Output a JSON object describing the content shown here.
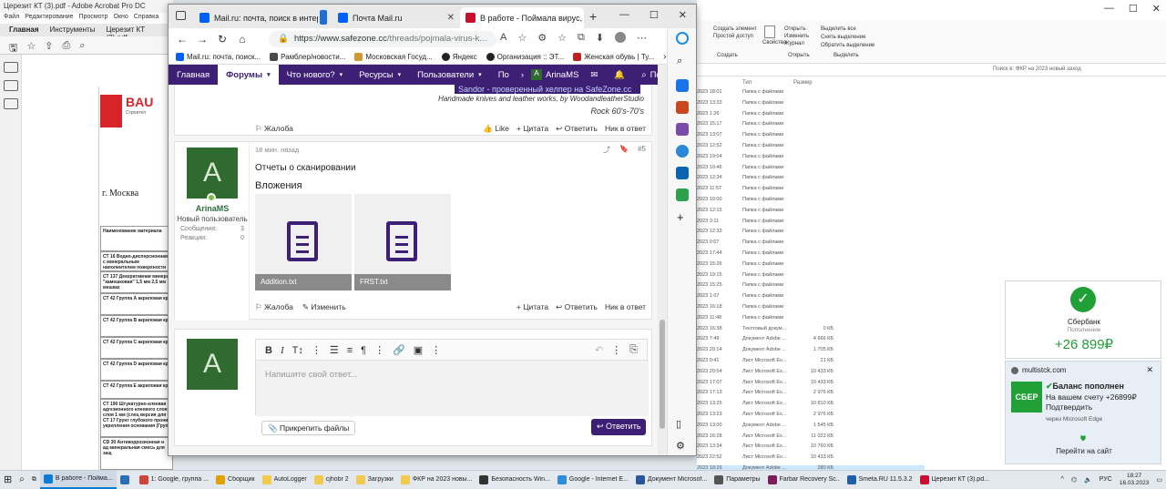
{
  "acrobat": {
    "title": "Церезит КТ (3).pdf - Adobe Acrobat Pro DC",
    "menu": [
      "Файл",
      "Редактирование",
      "Просмотр",
      "Окно",
      "Справка"
    ],
    "tabs": [
      "Главная",
      "Инструменты",
      "Церезит КТ (3).pdf"
    ],
    "logo_text": "BAU",
    "logo_sub": "Строител",
    "city": "г. Москва",
    "table_header": "Наименование материала",
    "rows": [
      "СТ 16 Водно-дисперсионная с минеральным наполнителем поверхности",
      "СТ 137 Декоративная минера \"камешковая\" 1,5 мм 2,5 мм мешках",
      "СТ 42 Группа А акриловая кр",
      "СТ 42 Группа В акриловая кр",
      "СТ 42 Группа С акриловая кр",
      "СТ 42 Группа D акриловая кр",
      "СТ 42 Группа Е акриловая кр",
      "СТ 190 Штукатурно-клеевая с адгезионного клеевого слоя слоя 1 мм (слец версия для б СТ 17 Грунт глубокого прони укрепления основания (Груп)",
      "СD 30 Антикоррозионная и ад минеральная смесь для защ"
    ]
  },
  "explorer": {
    "ribbon": {
      "select_group": [
        "Выделить все",
        "Снять выделение",
        "Обратить выделение"
      ],
      "select_label": "Выделить",
      "open_group": [
        "Открыть",
        "Изменить",
        "Журнал"
      ],
      "open_label": "Открыть",
      "create_group": [
        "Создать элемент",
        "Простой доступ"
      ],
      "create_label": "Создать",
      "props_label": "Свойства"
    },
    "search_placeholder": "Поиск в: ФКР на 2023 новый заход",
    "headers": [
      "Тип",
      "Размер"
    ],
    "rows": [
      {
        "date": "2023 18:01",
        "type": "Папка с файлами",
        "size": ""
      },
      {
        "date": "2023 13:33",
        "type": "Папка с файлами",
        "size": ""
      },
      {
        "date": "2023 1:26",
        "type": "Папка с файлами",
        "size": ""
      },
      {
        "date": "2023 15:17",
        "type": "Папка с файлами",
        "size": ""
      },
      {
        "date": "2023 13:07",
        "type": "Папка с файлами",
        "size": ""
      },
      {
        "date": "2023 12:52",
        "type": "Папка с файлами",
        "size": ""
      },
      {
        "date": "2023 19:04",
        "type": "Папка с файлами",
        "size": ""
      },
      {
        "date": "2023 10:46",
        "type": "Папка с файлами",
        "size": ""
      },
      {
        "date": "2023 12:34",
        "type": "Папка с файлами",
        "size": ""
      },
      {
        "date": "2023 11:57",
        "type": "Папка с файлами",
        "size": ""
      },
      {
        "date": "2023 10:00",
        "type": "Папка с файлами",
        "size": ""
      },
      {
        "date": "2023 12:15",
        "type": "Папка с файлами",
        "size": ""
      },
      {
        "date": "2023 3:11",
        "type": "Папка с файлами",
        "size": ""
      },
      {
        "date": "2023 12:33",
        "type": "Папка с файлами",
        "size": ""
      },
      {
        "date": "2023 0:07",
        "type": "Папка с файлами",
        "size": ""
      },
      {
        "date": "2023 17:44",
        "type": "Папка с файлами",
        "size": ""
      },
      {
        "date": "2023 15:26",
        "type": "Папка с файлами",
        "size": ""
      },
      {
        "date": "2023 19:15",
        "type": "Папка с файлами",
        "size": ""
      },
      {
        "date": "2023 15:25",
        "type": "Папка с файлами",
        "size": ""
      },
      {
        "date": "2023 1:07",
        "type": "Папка с файлами",
        "size": ""
      },
      {
        "date": "2023 16:18",
        "type": "Папка с файлами",
        "size": ""
      },
      {
        "date": "2023 11:48",
        "type": "Папка с файлами",
        "size": ""
      },
      {
        "date": "2023 16:38",
        "type": "Текстовый докум...",
        "size": "0 КБ"
      },
      {
        "date": "2023 7:49",
        "type": "Документ Adobe ...",
        "size": "4 666 КБ"
      },
      {
        "date": "2023 20:14",
        "type": "Документ Adobe ...",
        "size": "1 705 КБ"
      },
      {
        "date": "2023 0:41",
        "type": "Лист Microsoft Ex...",
        "size": "21 КБ"
      },
      {
        "date": "2023 20:54",
        "type": "Лист Microsoft Ex...",
        "size": "10 433 КБ"
      },
      {
        "date": "2023 17:07",
        "type": "Лист Microsoft Ex...",
        "size": "10 433 КБ"
      },
      {
        "date": "2023 17:13",
        "type": "Лист Microsoft Ex...",
        "size": "2 976 КБ"
      },
      {
        "date": "2023 13:25",
        "type": "Лист Microsoft Ex...",
        "size": "10 810 КБ"
      },
      {
        "date": "2023 13:23",
        "type": "Лист Microsoft Ex...",
        "size": "2 976 КБ"
      },
      {
        "date": "2023 13:00",
        "type": "Документ Adobe ...",
        "size": "1 545 КБ"
      },
      {
        "date": "2023 16:28",
        "type": "Лист Microsoft Ex...",
        "size": "11 022 КБ"
      },
      {
        "date": "2023 13:34",
        "type": "Лист Microsoft Ex...",
        "size": "10 760 КБ"
      },
      {
        "date": "2023 22:52",
        "type": "Лист Microsoft Ex...",
        "size": "10 433 КБ"
      },
      {
        "date": "2023 18:26",
        "type": "Документ Adobe ...",
        "size": "280 КБ"
      }
    ]
  },
  "edge": {
    "tabs": [
      {
        "label": "Mail.ru: почта, поиск в интерне",
        "color": "#005ff9"
      },
      {
        "label": "Почта Mail.ru",
        "color": "#005ff9"
      },
      {
        "label": "В работе - Поймала вирус, ком",
        "color": "#c8102e"
      }
    ],
    "new_tab": "+",
    "url_prefix": "https://www.safezone.cc",
    "url_rest": "/threads/pojmala-virus-k...",
    "bookmarks": [
      "Mail.ru: почта, поиск...",
      "Рамблер/новости...",
      "Московская Госуд...",
      "Яндекс",
      "Организация :: ЭТ...",
      "Женская обувь | Ту..."
    ],
    "win_controls": [
      "—",
      "☐",
      "✕"
    ]
  },
  "forum": {
    "nav": [
      {
        "label": "Главная",
        "active": false,
        "caret": false
      },
      {
        "label": "Форумы",
        "active": true,
        "caret": true
      },
      {
        "label": "Что нового?",
        "active": false,
        "caret": true
      },
      {
        "label": "Ресурсы",
        "active": false,
        "caret": true
      },
      {
        "label": "Пользователи",
        "active": false,
        "caret": true
      },
      {
        "label": "По",
        "active": false,
        "caret": false
      }
    ],
    "user_name": "ArinaMS",
    "search_label": "Поиск",
    "signature": {
      "banner": "Sandor - проверенный хелпер на SafeZone.cc",
      "line1": "Handmade knives and leather works, by WoodandleatherStudio",
      "line2": "Rock 60's-70's"
    },
    "post1_actions": {
      "report": "Жалоба",
      "like": "Like",
      "quote": "+ Цитата",
      "reply": "Ответить",
      "nick": "Ник в ответ"
    },
    "post2": {
      "time": "18 мин. назад",
      "post_num": "#5",
      "avatar_letter": "A",
      "author": "ArinaMS",
      "role": "Новый пользователь",
      "messages_label": "Сообщения:",
      "messages_value": "3",
      "reactions_label": "Реакции:",
      "reactions_value": "0",
      "body": "Отчеты о сканировании",
      "attachments_title": "Вложения",
      "attachments": [
        "Addition.txt",
        "FRST.txt"
      ],
      "actions": {
        "report": "Жалоба",
        "edit": "Изменить",
        "quote": "+ Цитата",
        "reply": "Ответить",
        "nick": "Ник в ответ"
      }
    },
    "reply": {
      "avatar_letter": "A",
      "placeholder": "Напишите свой ответ...",
      "attach_label": "Прикрепить файлы",
      "submit_label": "Ответить"
    }
  },
  "notifications": {
    "sber_card": {
      "title": "Сбербанк",
      "subtitle": "Пополнение",
      "amount": "+26 899₽"
    },
    "toast": {
      "source": "multistck.com",
      "logo": "СБЕР",
      "title": "Баланс пополнен",
      "body1": "На вашем счету +26899₽",
      "body2": "Подтвердить",
      "via": "через Microsoft Edge",
      "action": "Перейти на сайт"
    }
  },
  "taskbar": {
    "items": [
      {
        "label": "В работе - Поймa...",
        "color": "#0c7cd5"
      },
      {
        "label": "",
        "color": "#2a6fb5"
      },
      {
        "label": "1: Google, группа ...",
        "color": "#d04437"
      },
      {
        "label": "Сборщик",
        "color": "#e0a000"
      },
      {
        "label": "AutoLogger",
        "color": "#f2c94c"
      },
      {
        "label": "cjhobr 2",
        "color": "#f2c94c"
      },
      {
        "label": "Загрузки",
        "color": "#f2c94c"
      },
      {
        "label": "ФКР на 2023 новы...",
        "color": "#f2c94c"
      },
      {
        "label": "Безопасность Win...",
        "color": "#333"
      },
      {
        "label": "Google - Internet E...",
        "color": "#2d8cdb"
      },
      {
        "label": "Документ Microsof...",
        "color": "#2b579a"
      },
      {
        "label": "Параметры",
        "color": "#555"
      },
      {
        "label": "Farbar Recovery Sc...",
        "color": "#7a1f5c"
      },
      {
        "label": "Smeta.RU  11.5.3.2",
        "color": "#1f5fa8"
      },
      {
        "label": "Церезит КТ (3).pd...",
        "color": "#c8102e"
      }
    ],
    "lang": "РУС",
    "time": "18:27",
    "date": "16.03.2023"
  }
}
